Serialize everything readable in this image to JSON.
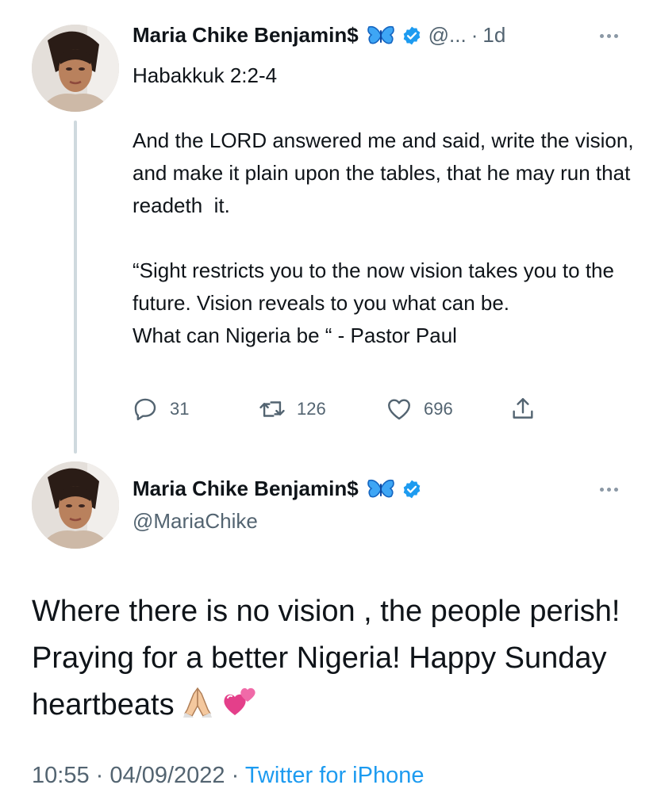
{
  "tweet1": {
    "display_name": "Maria Chike Benjamin$",
    "handle_short": "@...",
    "separator": "·",
    "time": "1d",
    "text": "Habakkuk 2:2-4\n\nAnd the LORD answered me and said, write the vision, and make it plain upon the tables, that he may run that readeth  it.\n\n“Sight restricts you to the now vision takes you to the future. Vision reveals to you what can be.\nWhat can Nigeria be “ - Pastor Paul",
    "replies": "31",
    "retweets": "126",
    "likes": "696"
  },
  "tweet2": {
    "display_name": "Maria Chike Benjamin$",
    "handle": "@MariaChike",
    "text": "Where there is no vision , the people perish! Praying for a better Nigeria! Happy Sunday heartbeats",
    "time": "10:55",
    "separator1": "·",
    "date": "04/09/2022",
    "separator2": "·",
    "source": "Twitter for iPhone"
  },
  "colors": {
    "text_primary": "#0f1419",
    "text_secondary": "#536471",
    "accent_blue": "#1d9bf0",
    "thread_line": "#cfd9de"
  },
  "icons": {
    "badge_emoji": "butterfly-icon",
    "verified": "verified-badge-icon",
    "reply": "reply-icon",
    "retweet": "retweet-icon",
    "like": "heart-icon",
    "share": "share-icon",
    "more": "more-options-icon",
    "text_emojis": [
      "folded-hands-emoji",
      "two-hearts-emoji"
    ]
  }
}
